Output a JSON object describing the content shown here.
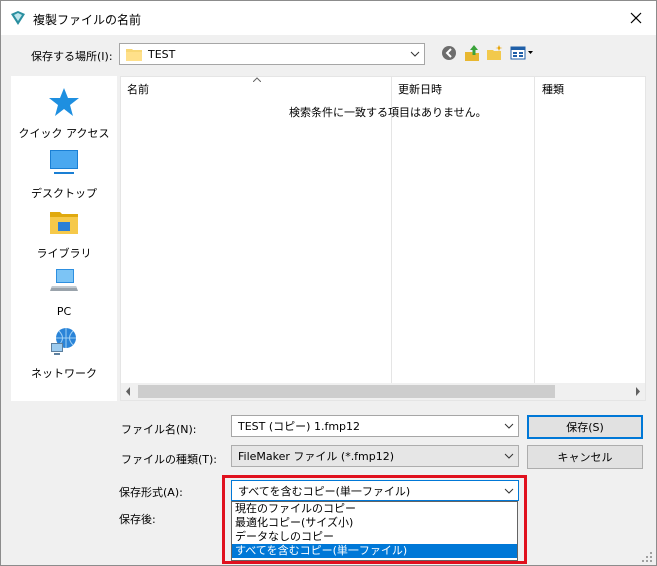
{
  "window": {
    "title": "複製ファイルの名前"
  },
  "location": {
    "label": "保存する場所(I):",
    "folder": "TEST"
  },
  "places": [
    {
      "label": "クイック アクセス",
      "icon": "star-icon"
    },
    {
      "label": "デスクトップ",
      "icon": "desktop-icon"
    },
    {
      "label": "ライブラリ",
      "icon": "library-icon"
    },
    {
      "label": "PC",
      "icon": "pc-icon"
    },
    {
      "label": "ネットワーク",
      "icon": "network-icon"
    }
  ],
  "filelist": {
    "columns": [
      "名前",
      "更新日時",
      "種類"
    ],
    "empty_message": "検索条件に一致する項目はありません。"
  },
  "filename": {
    "label": "ファイル名(N):",
    "value": "TEST (コピー) 1.fmp12"
  },
  "filetype": {
    "label": "ファイルの種類(T):",
    "value": "FileMaker ファイル (*.fmp12)"
  },
  "buttons": {
    "save": "保存(S)",
    "cancel": "キャンセル"
  },
  "save_format": {
    "label": "保存形式(A):",
    "value": "すべてを含むコピー(単一ファイル)",
    "options": [
      "現在のファイルのコピー",
      "最適化コピー(サイズ小)",
      "データなしのコピー",
      "すべてを含むコピー(単一ファイル)"
    ],
    "selected_index": 3
  },
  "after_save": {
    "label": "保存後:"
  },
  "colors": {
    "accent": "#0078d7",
    "highlight": "#e0101e"
  }
}
